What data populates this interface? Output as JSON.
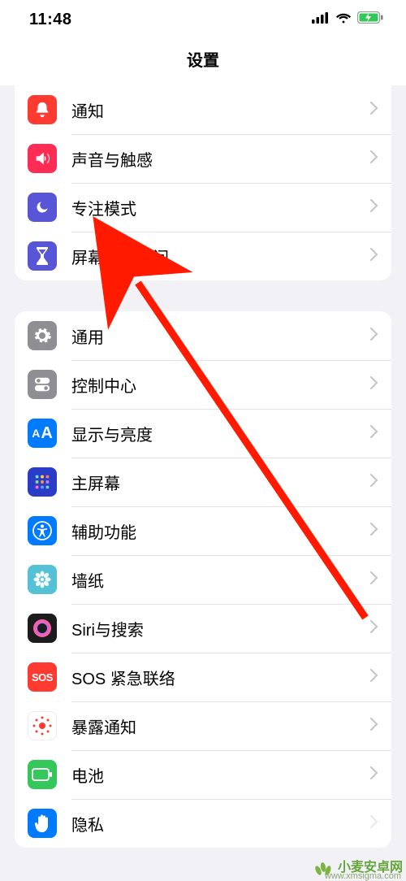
{
  "status": {
    "time": "11:48"
  },
  "header": {
    "title": "设置"
  },
  "group1": {
    "notifications": "通知",
    "sounds": "声音与触感",
    "focus": "专注模式",
    "screentime": "屏幕使用时间"
  },
  "group2": {
    "general": "通用",
    "control": "控制中心",
    "display": "显示与亮度",
    "home": "主屏幕",
    "accessibility": "辅助功能",
    "wallpaper": "墙纸",
    "siri": "Siri与搜索",
    "sos": "SOS 紧急联络",
    "exposure": "暴露通知",
    "battery": "电池",
    "privacy": "隐私"
  },
  "watermark": {
    "text": "小麦安卓网",
    "url": "www.xmsigma.com"
  },
  "colors": {
    "notifications": "#ff3a30",
    "sounds": "#ff2d55",
    "focus": "#5856d6",
    "screentime": "#5856d6",
    "general": "#8e8e93",
    "control": "#8e8e93",
    "display": "#007aff",
    "home": "#2b3cc9",
    "accessibility": "#007aff",
    "wallpaper": "#54c1d6",
    "siri": "#1c1c1e",
    "sos": "#ff3a30",
    "exposure": "#ffffff",
    "battery": "#34c759",
    "privacy": "#007aff"
  }
}
